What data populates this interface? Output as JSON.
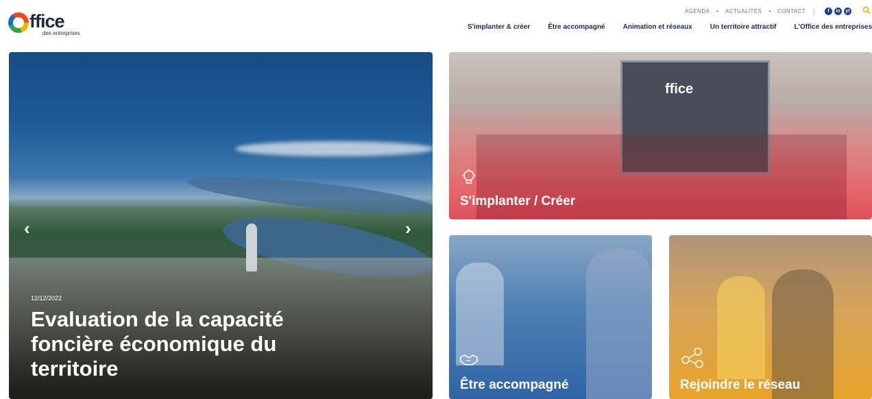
{
  "brand": {
    "logo_letter_word": "ffice",
    "logo_sub": "des entreprises"
  },
  "utility_links": [
    "AGENDA",
    "ACTUALITÉS",
    "CONTACT"
  ],
  "social": [
    "f",
    "in",
    "yt"
  ],
  "nav": [
    "S'implanter & créer",
    "Être accompagné",
    "Animation et réseaux",
    "Un territoire attractif",
    "L'Office des entreprises"
  ],
  "hero": {
    "date": "12/12/2022",
    "title": "Evaluation de la capacité foncière économique du territoire",
    "prev": "‹",
    "next": "›"
  },
  "tiles": [
    {
      "label": "S'implanter / Créer",
      "icon": "lightbulb-icon",
      "sign": "ffice"
    },
    {
      "label": "Être accompagné",
      "icon": "handshake-icon"
    },
    {
      "label": "Rejoindre le réseau",
      "icon": "network-icon"
    }
  ],
  "colors": {
    "accent": "#f2a900",
    "navy": "#1e2a44",
    "tile_red": "#e0505a",
    "tile_blue": "#2f64a5",
    "tile_gold": "#e7a32b"
  }
}
